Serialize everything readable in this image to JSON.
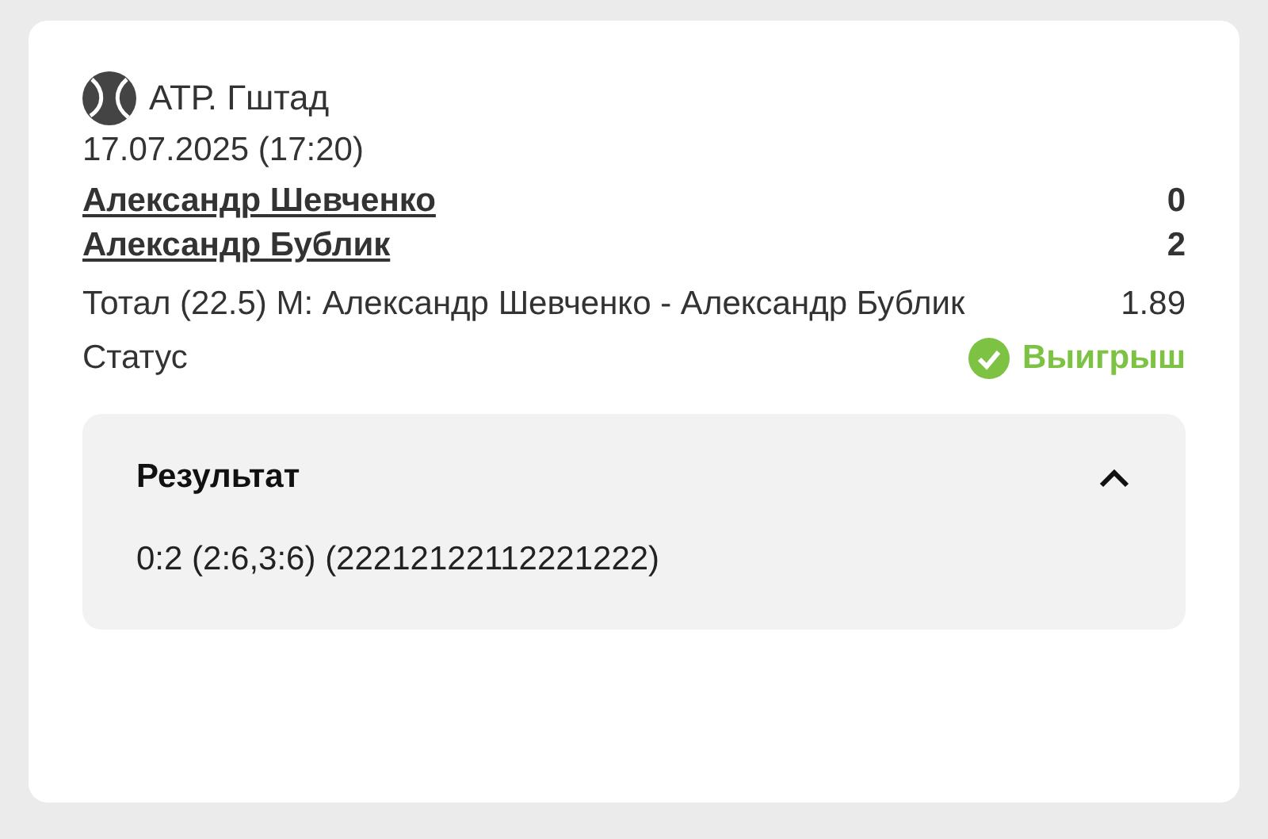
{
  "tournament": "АТР. Гштад",
  "datetime": "17.07.2025 (17:20)",
  "players": [
    {
      "name": "Александр Шевченко",
      "score": "0"
    },
    {
      "name": "Александр Бублик",
      "score": "2"
    }
  ],
  "bet": {
    "market": "Тотал (22.5) М: Александр Шевченко - Александр Бублик",
    "odds": "1.89"
  },
  "status": {
    "label": "Статус",
    "value": "Выигрыш",
    "kind": "won"
  },
  "result": {
    "title": "Результат",
    "expanded": true,
    "text": "0:2 (2:6,3:6) (22212122112221222)"
  }
}
